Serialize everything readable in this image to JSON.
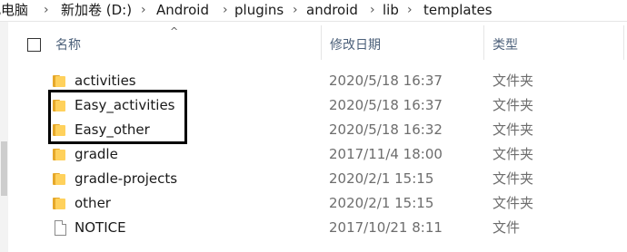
{
  "breadcrumb": {
    "items": [
      "此电脑",
      "新加卷 (D:)",
      "Android",
      "plugins",
      "android",
      "lib",
      "templates"
    ],
    "separator": "›"
  },
  "header": {
    "name_label": "名称",
    "date_label": "修改日期",
    "type_label": "类型",
    "sort_indicator": "^"
  },
  "files": [
    {
      "name": "activities",
      "date": "2020/5/18 16:37",
      "type": "文件夹",
      "icon": "folder-icon"
    },
    {
      "name": "Easy_activities",
      "date": "2020/5/18 16:37",
      "type": "文件夹",
      "icon": "folder-icon"
    },
    {
      "name": "Easy_other",
      "date": "2020/5/18 16:32",
      "type": "文件夹",
      "icon": "folder-icon"
    },
    {
      "name": "gradle",
      "date": "2017/11/4 18:00",
      "type": "文件夹",
      "icon": "folder-icon"
    },
    {
      "name": "gradle-projects",
      "date": "2020/2/1 15:15",
      "type": "文件夹",
      "icon": "folder-icon"
    },
    {
      "name": "other",
      "date": "2020/2/1 15:15",
      "type": "文件夹",
      "icon": "folder-icon"
    },
    {
      "name": "NOTICE",
      "date": "2017/10/21 8:11",
      "type": "文件",
      "icon": "file-icon"
    }
  ],
  "colors": {
    "folder_front": "#ffd15c",
    "folder_back": "#e6a82a",
    "header_text": "#4c607a",
    "secondary_text": "#6d6d6d",
    "highlight_border": "#000000"
  }
}
